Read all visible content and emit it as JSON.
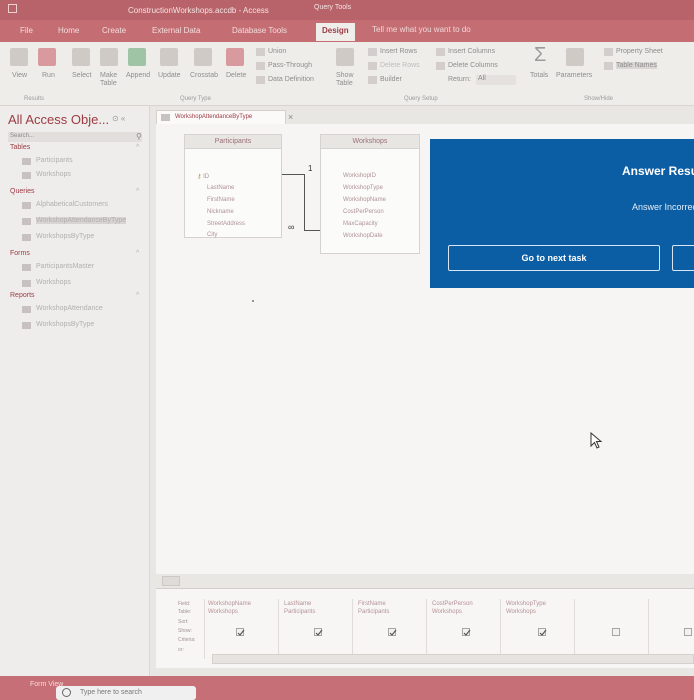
{
  "window": {
    "title": "ConstructionWorkshops.accdb - Access",
    "context_label": "Query Tools"
  },
  "tabs": [
    {
      "label": "File"
    },
    {
      "label": "Home"
    },
    {
      "label": "Create"
    },
    {
      "label": "External Data"
    },
    {
      "label": "Database Tools"
    },
    {
      "label": "Design"
    }
  ],
  "tell_me": "Tell me what you want to do",
  "ribbon": {
    "results": {
      "view": "View",
      "run": "Run",
      "group": "Results"
    },
    "query_type": {
      "select": "Select",
      "make_table_line1": "Make",
      "make_table_line2": "Table",
      "append": "Append",
      "update": "Update",
      "crosstab": "Crosstab",
      "delete": "Delete",
      "union": "Union",
      "pass_through": "Pass-Through",
      "data_definition": "Data Definition",
      "group": "Query Type"
    },
    "query_setup": {
      "show_table_line1": "Show",
      "show_table_line2": "Table",
      "insert_rows": "Insert Rows",
      "delete_rows": "Delete Rows",
      "builder": "Builder",
      "insert_columns": "Insert Columns",
      "delete_columns": "Delete Columns",
      "return": "Return:",
      "return_value": "All",
      "group": "Query Setup"
    },
    "show_hide": {
      "totals": "Totals",
      "parameters": "Parameters",
      "property_sheet": "Property Sheet",
      "table_names": "Table Names",
      "group": "Show/Hide"
    }
  },
  "nav": {
    "title": "All Access Obje...",
    "search_placeholder": "Search...",
    "categories": {
      "tables": "Tables",
      "queries": "Queries",
      "forms": "Forms",
      "reports": "Reports"
    },
    "tables": [
      "Participants",
      "Workshops"
    ],
    "queries": [
      "AlphabeticalCustomers",
      "WorkshopAttendanceByType",
      "WorkshopsByType"
    ],
    "forms": [
      "ParticipantsMaster",
      "Workshops"
    ],
    "reports": [
      "WorkshopAttendance",
      "WorkshopsByType"
    ]
  },
  "query_tab": {
    "label": "WorkshopAttendanceByType"
  },
  "tables": {
    "participants": {
      "name": "Participants",
      "fields": [
        "ID",
        "LastName",
        "FirstName",
        "Nickname",
        "StreetAddress",
        "City"
      ]
    },
    "workshops": {
      "name": "Workshops",
      "fields": [
        "WorkshopID",
        "WorkshopType",
        "WorkshopName",
        "CostPerPerson",
        "MaxCapacity",
        "WorkshopDate"
      ]
    },
    "join": {
      "one": "1",
      "many": "∞"
    }
  },
  "answer": {
    "title": "Answer Results",
    "message": "Answer Incorrect",
    "next_button": "Go to next task"
  },
  "grid": {
    "row_labels": [
      "Field:",
      "Table:",
      "Sort:",
      "Show:",
      "Criteria:",
      "or:"
    ],
    "columns": [
      {
        "field": "WorkshopName",
        "table": "Workshops",
        "show": true
      },
      {
        "field": "LastName",
        "table": "Participants",
        "show": true
      },
      {
        "field": "FirstName",
        "table": "Participants",
        "show": true
      },
      {
        "field": "CostPerPerson",
        "table": "Workshops",
        "show": true
      },
      {
        "field": "WorkshopType",
        "table": "Workshops",
        "show": true
      }
    ]
  },
  "status": {
    "text": "Form View"
  },
  "taskbar": {
    "search_text": "Type here to search"
  }
}
